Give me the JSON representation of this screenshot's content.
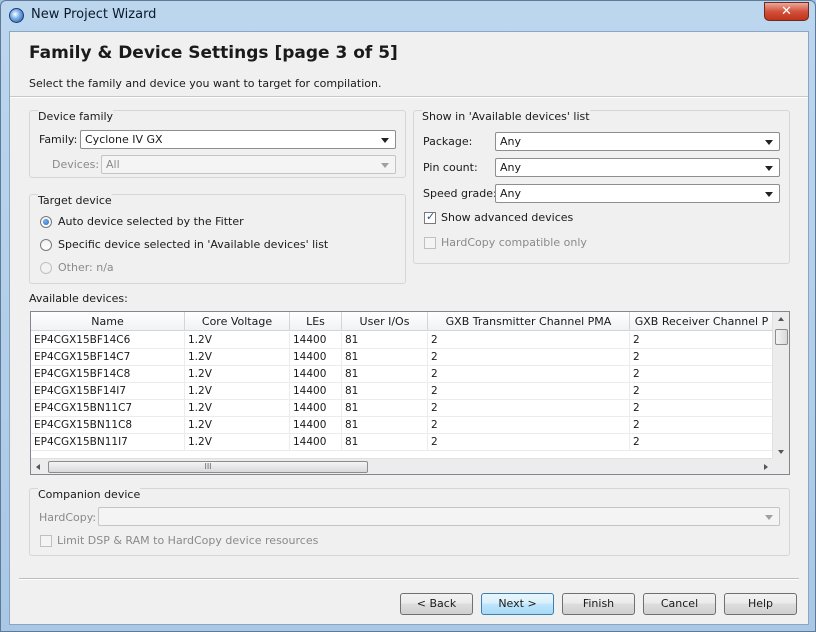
{
  "window": {
    "title": "New Project Wizard",
    "close_glyph": "✕"
  },
  "header": {
    "title": "Family & Device Settings [page 3 of 5]",
    "subtitle": "Select the family and device you want to target for compilation."
  },
  "device_family": {
    "group_label": "Device family",
    "family_label": "Family:",
    "family_value": "Cyclone IV GX",
    "devices_label": "Devices:",
    "devices_value": "All"
  },
  "target_device": {
    "group_label": "Target device",
    "options": [
      {
        "label": "Auto device selected by the Fitter",
        "selected": true,
        "enabled": true
      },
      {
        "label": "Specific device selected in 'Available devices' list",
        "selected": false,
        "enabled": true
      },
      {
        "label": "Other:  n/a",
        "selected": false,
        "enabled": false
      }
    ]
  },
  "filters": {
    "group_label": "Show in 'Available devices' list",
    "package_label": "Package:",
    "package_value": "Any",
    "pin_count_label": "Pin count:",
    "pin_count_value": "Any",
    "speed_grade_label": "Speed grade:",
    "speed_grade_value": "Any",
    "show_advanced_label": "Show advanced devices",
    "show_advanced_checked": true,
    "hardcopy_compatible_label": "HardCopy compatible only",
    "hardcopy_compatible_checked": false
  },
  "devices_table": {
    "label": "Available devices:",
    "columns": [
      "Name",
      "Core Voltage",
      "LEs",
      "User I/Os",
      "GXB Transmitter Channel PMA",
      "GXB Receiver Channel P"
    ],
    "rows": [
      [
        "EP4CGX15BF14C6",
        "1.2V",
        "14400",
        "81",
        "2",
        "2"
      ],
      [
        "EP4CGX15BF14C7",
        "1.2V",
        "14400",
        "81",
        "2",
        "2"
      ],
      [
        "EP4CGX15BF14C8",
        "1.2V",
        "14400",
        "81",
        "2",
        "2"
      ],
      [
        "EP4CGX15BF14I7",
        "1.2V",
        "14400",
        "81",
        "2",
        "2"
      ],
      [
        "EP4CGX15BN11C7",
        "1.2V",
        "14400",
        "81",
        "2",
        "2"
      ],
      [
        "EP4CGX15BN11C8",
        "1.2V",
        "14400",
        "81",
        "2",
        "2"
      ],
      [
        "EP4CGX15BN11I7",
        "1.2V",
        "14400",
        "81",
        "2",
        "2"
      ]
    ],
    "hscroll_grip": "III"
  },
  "companion": {
    "group_label": "Companion device",
    "hardcopy_label": "HardCopy:",
    "hardcopy_value": "",
    "limit_label": "Limit DSP & RAM to HardCopy device resources",
    "limit_checked": false
  },
  "buttons": {
    "back": "< Back",
    "next": "Next >",
    "finish": "Finish",
    "cancel": "Cancel",
    "help": "Help"
  }
}
